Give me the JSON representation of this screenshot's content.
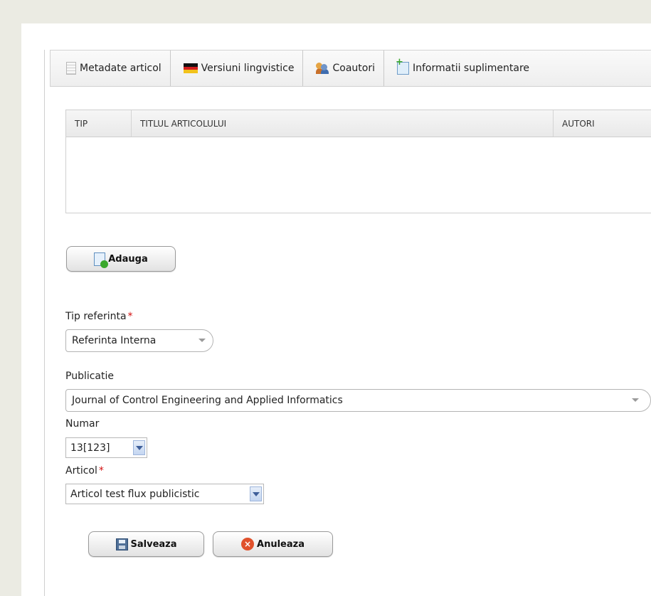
{
  "tabs": [
    {
      "label": "Metadate articol",
      "icon": "document-icon"
    },
    {
      "label": "Versiuni lingvistice",
      "icon": "flag-icon"
    },
    {
      "label": "Coautori",
      "icon": "users-icon"
    },
    {
      "label": "Informatii suplimentare",
      "icon": "new-document-icon"
    }
  ],
  "table": {
    "columns": [
      "TIP",
      "TITLUL ARTICOLULUI",
      "AUTORI"
    ],
    "rows": []
  },
  "add_button": {
    "label": "Adauga",
    "icon": "add-document-icon"
  },
  "form": {
    "tip_referinta": {
      "label": "Tip referinta",
      "required_mark": "*",
      "value": "Referinta Interna"
    },
    "publicatie": {
      "label": "Publicatie",
      "value": "Journal of Control Engineering and Applied Informatics"
    },
    "numar": {
      "label": "Numar",
      "value": "13[123]"
    },
    "articol": {
      "label": "Articol",
      "required_mark": "*",
      "value": "Articol test flux publicistic"
    }
  },
  "actions": {
    "save_label": "Salveaza",
    "cancel_label": "Anuleaza"
  },
  "colors": {
    "background": "#ebebe3",
    "required": "#d31010",
    "border": "#cfcfcf"
  }
}
